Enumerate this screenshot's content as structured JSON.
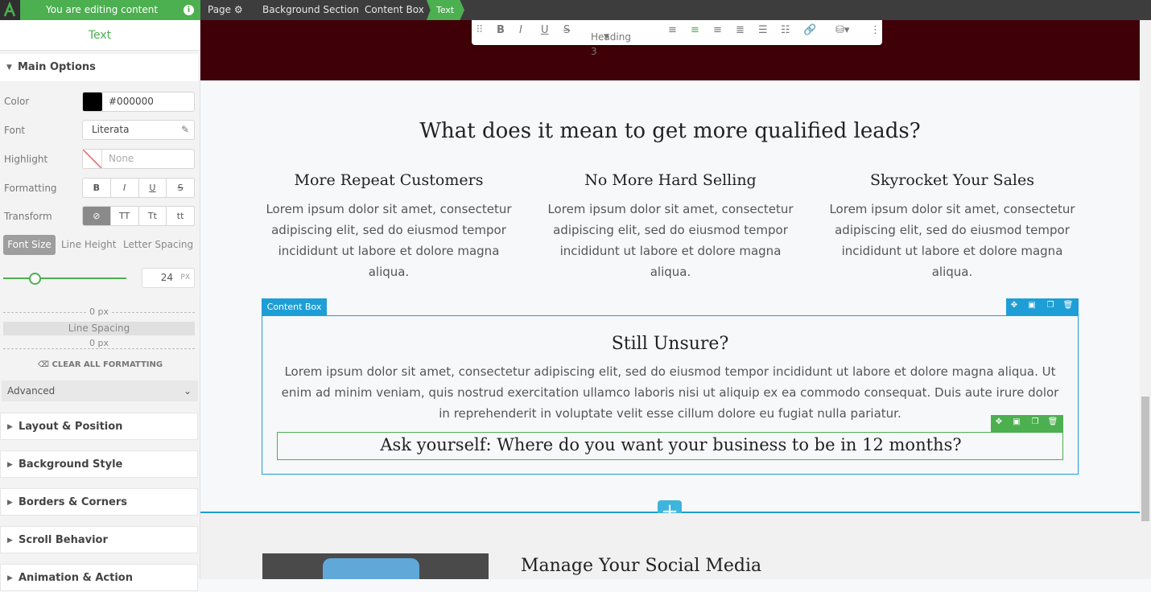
{
  "topbar": {
    "editing_label": "You are editing content",
    "breadcrumbs": [
      "Page",
      "Background Section",
      "Content Box",
      "Text"
    ]
  },
  "panel": {
    "title": "Text",
    "main_options": "Main Options",
    "color_label": "Color",
    "color_value": "#000000",
    "font_label": "Font",
    "font_value": "Literata",
    "highlight_label": "Highlight",
    "highlight_value": "None",
    "formatting_label": "Formatting",
    "formatting_buttons": [
      "B",
      "I",
      "U",
      "S"
    ],
    "transform_label": "Transform",
    "transform_buttons": [
      "⊘",
      "TT",
      "Tt",
      "tt"
    ],
    "tabs": [
      "Font Size",
      "Line Height",
      "Letter Spacing"
    ],
    "font_size_value": "24",
    "font_size_unit": "PX",
    "spacing_top": "0 px",
    "line_spacing_label": "Line Spacing",
    "spacing_bottom": "0 px",
    "clear_formatting": "CLEAR ALL FORMATTING",
    "advanced": "Advanced",
    "sections": [
      "Layout & Position",
      "Background Style",
      "Borders & Corners",
      "Scroll Behavior",
      "Animation & Action"
    ]
  },
  "toolbar": {
    "heading_select": "Heading 3"
  },
  "content": {
    "main_heading": "What does it mean to get more qualified leads?",
    "columns": [
      {
        "title": "More Repeat Customers",
        "body": "Lorem ipsum dolor sit amet, consectetur adipiscing elit, sed do eiusmod tempor incididunt ut labore et dolore magna aliqua."
      },
      {
        "title": "No More Hard Selling",
        "body": "Lorem ipsum dolor sit amet, consectetur adipiscing elit, sed do eiusmod tempor incididunt ut labore et dolore magna aliqua."
      },
      {
        "title": "Skyrocket Your Sales",
        "body": "Lorem ipsum dolor sit amet, consectetur adipiscing elit, sed do eiusmod tempor incididunt ut labore et dolore magna aliqua."
      }
    ],
    "content_box_tag": "Content Box",
    "unsure_heading": "Still Unsure?",
    "unsure_body": "Lorem ipsum dolor sit amet, consectetur adipiscing elit, sed do eiusmod tempor incididunt ut labore et dolore magna aliqua. Ut enim ad minim veniam, quis nostrud exercitation ullamco laboris nisi ut aliquip ex ea commodo consequat. Duis aute irure dolor in reprehenderit in voluptate velit esse cillum dolore eu fugiat nulla pariatur.",
    "ask_heading": "Ask yourself: Where do you want your business to be in 12 months?",
    "social_heading": "Manage Your Social Media"
  },
  "colors": {
    "accent_green": "#4caf50",
    "accent_blue": "#1e9ed6",
    "hero_bg": "#3f0008"
  }
}
